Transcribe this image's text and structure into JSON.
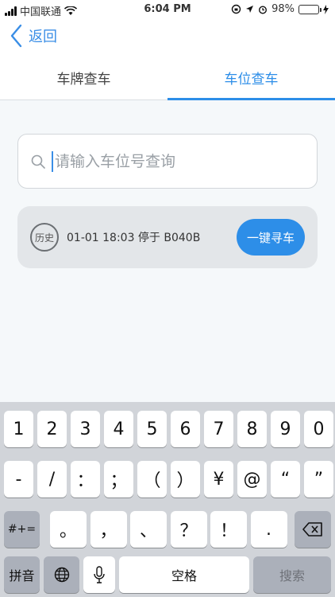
{
  "status_bar": {
    "carrier": "中国联通",
    "time": "6:04 PM",
    "battery": "98%",
    "battery_level": 0.98
  },
  "nav": {
    "back_label": "返回"
  },
  "tabs": [
    {
      "label": "车牌查车",
      "active": false
    },
    {
      "label": "车位查车",
      "active": true
    }
  ],
  "search": {
    "placeholder": "请输入车位号查询",
    "value": ""
  },
  "history": {
    "badge": "历史",
    "text": "01-01 18:03 停于 B040B",
    "button": "一键寻车"
  },
  "keyboard": {
    "row1": [
      "1",
      "2",
      "3",
      "4",
      "5",
      "6",
      "7",
      "8",
      "9",
      "0"
    ],
    "row2": [
      "-",
      "/",
      "：",
      "；",
      "（",
      "）",
      "¥",
      "@",
      "“",
      "”"
    ],
    "row3_left": "#+=",
    "row3": [
      "。",
      "，",
      "、",
      "？",
      "！",
      "."
    ],
    "row4": {
      "pinyin": "拼音",
      "space": "空格",
      "search": "搜索"
    }
  },
  "colors": {
    "accent": "#2d8ee8",
    "battery": "#4cd964"
  }
}
